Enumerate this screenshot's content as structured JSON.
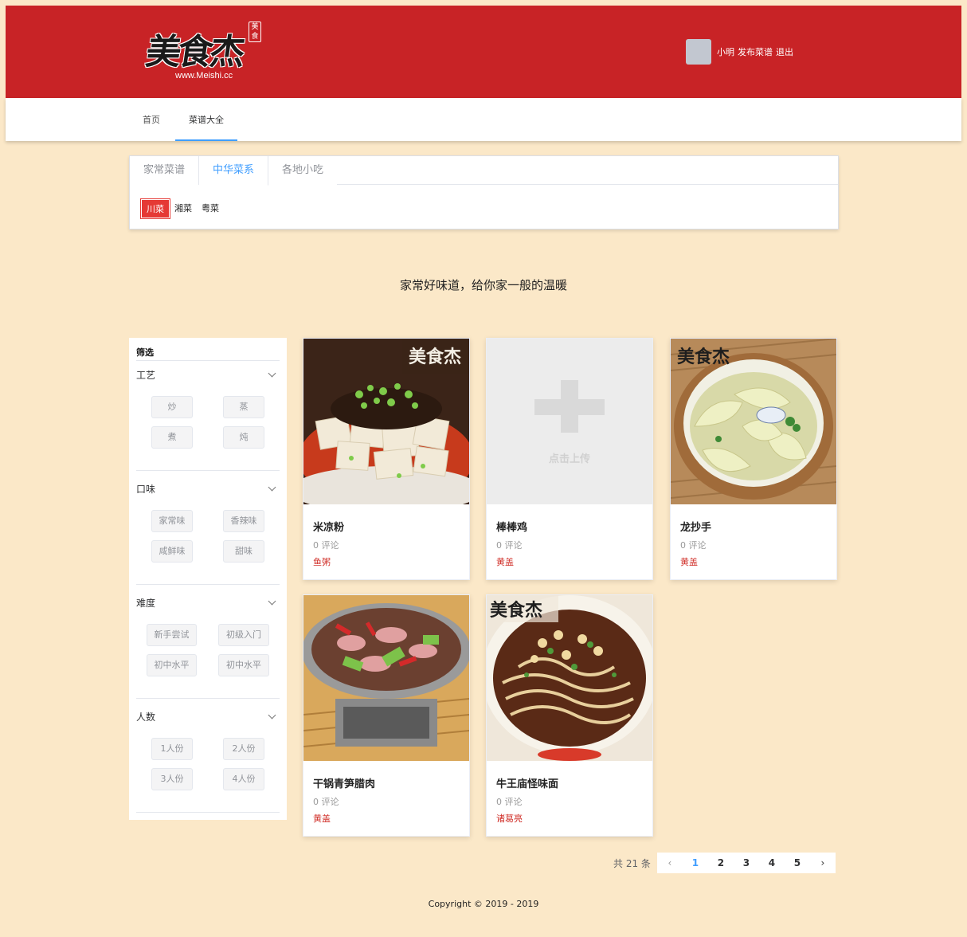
{
  "header": {
    "logo_text": "美食杰",
    "logo_seal": "美食",
    "logo_url": "www.Meishi.cc",
    "user_name": "小明",
    "publish_label": "发布菜谱",
    "logout_label": "退出"
  },
  "nav": {
    "items": [
      {
        "label": "首页"
      },
      {
        "label": "菜谱大全"
      }
    ],
    "active_index": 1
  },
  "categories": {
    "tabs": [
      "家常菜谱",
      "中华菜系",
      "各地小吃"
    ],
    "active_tab": 1,
    "subs": [
      "川菜",
      "湘菜",
      "粤菜"
    ],
    "active_sub": 0
  },
  "slogan": "家常好味道，给你家一般的温暖",
  "filter": {
    "title": "筛选",
    "groups": [
      {
        "label": "工艺",
        "options": [
          "炒",
          "蒸",
          "煮",
          "炖"
        ]
      },
      {
        "label": "口味",
        "options": [
          "家常味",
          "香辣味",
          "咸鲜味",
          "甜味"
        ]
      },
      {
        "label": "难度",
        "options": [
          "新手尝试",
          "初级入门",
          "初中水平",
          "初中水平"
        ]
      },
      {
        "label": "人数",
        "options": [
          "1人份",
          "2人份",
          "3人份",
          "4人份"
        ]
      }
    ]
  },
  "recipes": [
    {
      "name": "米凉粉",
      "comments": "0 评论",
      "author": "鱼粥",
      "image": "dish-tofu"
    },
    {
      "name": "棒棒鸡",
      "comments": "0 评论",
      "author": "黄盖",
      "image": "upload-placeholder",
      "placeholder_text": "点击上传"
    },
    {
      "name": "龙抄手",
      "comments": "0 评论",
      "author": "黄盖",
      "image": "dish-wonton"
    },
    {
      "name": "干锅青笋腊肉",
      "comments": "0 评论",
      "author": "黄盖",
      "image": "dish-drypot"
    },
    {
      "name": "牛王庙怪味面",
      "comments": "0 评论",
      "author": "诸葛亮",
      "image": "dish-noodles"
    }
  ],
  "pagination": {
    "total_text": "共 21 条",
    "pages": [
      "1",
      "2",
      "3",
      "4",
      "5"
    ],
    "current": 1
  },
  "footer": "Copyright © 2019 - 2019",
  "colors": {
    "page_bg": "#fbe8c8",
    "header_red": "#c82326",
    "accent_blue": "#409eff",
    "tag_red": "#e53935",
    "author_red": "#d0302a"
  }
}
